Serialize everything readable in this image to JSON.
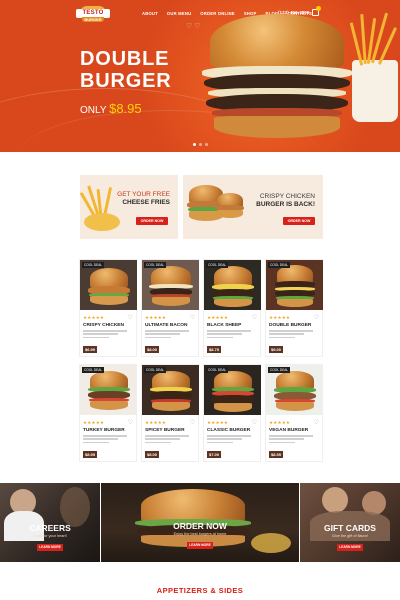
{
  "header": {
    "logo_top": "TESTO",
    "logo_bottom": "BURGER",
    "nav": [
      "ABOUT",
      "OUR MENU",
      "ORDER ONLINE",
      "SHOP",
      "BLOG",
      "CONTACTS"
    ],
    "phone": "(123) 456-7890"
  },
  "hero": {
    "title_line1": "DOUBLE",
    "title_line2": "BURGER",
    "price_prefix": "ONLY",
    "price": "$8.95"
  },
  "promos": [
    {
      "line1": "GET YOUR FREE",
      "line2": "CHEESE FRIES",
      "button": "ORDER NOW"
    },
    {
      "line1": "CRISPY CHICKEN",
      "line2": "BURGER IS BACK!",
      "button": "ORDER NOW"
    }
  ],
  "products": [
    {
      "tag": "COOL DEAL",
      "name": "CRISPY CHICKEN",
      "price": "$6.99"
    },
    {
      "tag": "COOL DEAL",
      "name": "ULTIMATE BACON",
      "price": "$8.00"
    },
    {
      "tag": "COOL DEAL",
      "name": "BLACK SHEEP",
      "price": "$8.75"
    },
    {
      "tag": "COOL DEAL",
      "name": "DOUBLE BURGER",
      "price": "$9.00"
    },
    {
      "tag": "COOL DEAL",
      "name": "TURKEY BURGER",
      "price": "$8.95"
    },
    {
      "tag": "COOL DEAL",
      "name": "SPICEY BURGER",
      "price": "$8.00"
    },
    {
      "tag": "COOL DEAL",
      "name": "CLASSIC BURGER",
      "price": "$7.00"
    },
    {
      "tag": "COOL DEAL",
      "name": "VEGAN BURGER",
      "price": "$8.95"
    }
  ],
  "banners": [
    {
      "title": "CAREERS",
      "sub": "Work for your heart!",
      "button": "LEARN MORE"
    },
    {
      "title": "ORDER NOW",
      "sub": "Enjoy the best burgers at home",
      "button": "LEARN MORE"
    },
    {
      "title": "GIFT CARDS",
      "sub": "Give the gift of flavor!",
      "button": "LEARN MORE"
    }
  ],
  "section": {
    "title": "APPETIZERS & SIDES"
  },
  "colors": {
    "brand_orange": "#d9481c",
    "brand_red": "#d7221b",
    "price_gold": "#ffd200",
    "star": "#f3a71c"
  }
}
